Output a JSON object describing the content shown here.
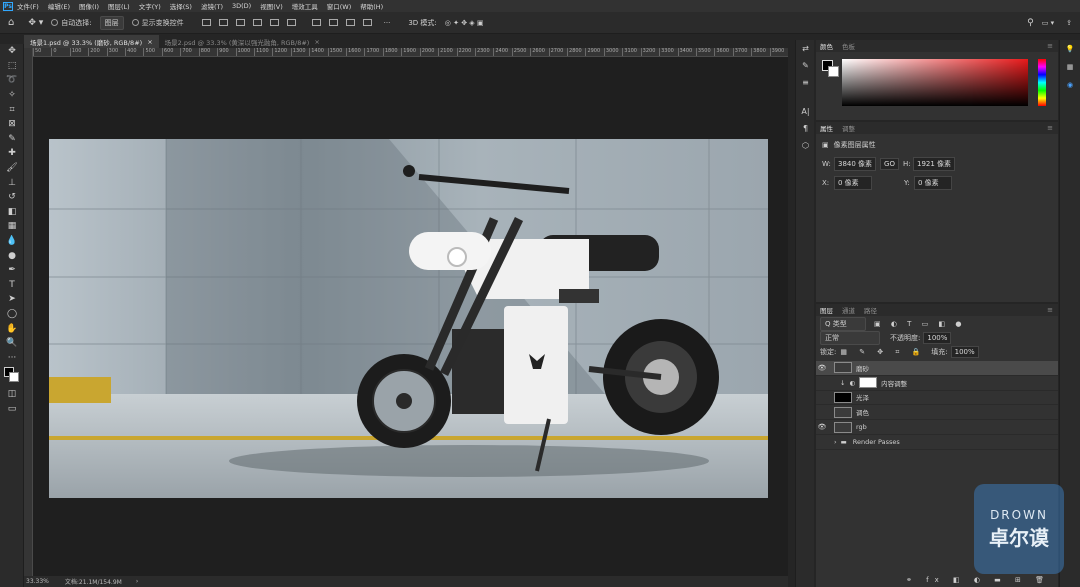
{
  "app": {
    "logo": "Ps"
  },
  "menu": [
    "文件(F)",
    "编辑(E)",
    "图像(I)",
    "图层(L)",
    "文字(Y)",
    "选择(S)",
    "滤镜(T)",
    "3D(D)",
    "视图(V)",
    "增效工具",
    "窗口(W)",
    "帮助(H)"
  ],
  "options": {
    "auto_select": "自动选择:",
    "auto_select_value": "图层",
    "show_transform": "显示变换控件",
    "mode_3d": "3D 模式:"
  },
  "tabs": [
    {
      "label": "场景1.psd @ 33.3% (磨砂, RGB/8#)",
      "active": true
    },
    {
      "label": "场景2.psd @ 33.3% (黄深以强光融角, RGB/8#)",
      "active": false
    }
  ],
  "ruler_ticks": [
    "50",
    "0",
    "100",
    "200",
    "300",
    "400",
    "500",
    "600",
    "700",
    "800",
    "900",
    "1000",
    "1100",
    "1200",
    "1300",
    "1400",
    "1500",
    "1600",
    "1700",
    "1800",
    "1900",
    "2000",
    "2100",
    "2200",
    "2300",
    "2400",
    "2500",
    "2600",
    "2700",
    "2800",
    "2900",
    "3000",
    "3100",
    "3200",
    "3300",
    "3400",
    "3500",
    "3600",
    "3700",
    "3800",
    "3900"
  ],
  "status": {
    "zoom": "33.33%",
    "doc": "文档:21.1M/154.9M"
  },
  "color_panel": {
    "tabs": [
      "颜色",
      "色板"
    ]
  },
  "properties": {
    "tabs": [
      "属性",
      "调整"
    ],
    "title": "像素图层属性",
    "w_label": "W:",
    "w_value": "3840 像素",
    "h_label": "H:",
    "h_value": "1921 像素",
    "x_label": "X:",
    "x_value": "0 像素",
    "y_label": "Y:",
    "y_value": "0 像素",
    "link": "GO"
  },
  "layers_panel": {
    "tabs": [
      "图层",
      "通道",
      "路径"
    ],
    "filter": "Q 类型",
    "blend": "正常",
    "opacity_label": "不透明度:",
    "opacity": "100%",
    "lock_label": "锁定:",
    "fill_label": "填充:",
    "fill": "100%",
    "layers": [
      {
        "name": "磨砂",
        "visible": true,
        "selected": true,
        "thumb": "img"
      },
      {
        "name": "内容调整",
        "visible": false,
        "selected": false,
        "thumb": "white",
        "indent": true
      },
      {
        "name": "光泽",
        "visible": false,
        "selected": false,
        "thumb": "black"
      },
      {
        "name": "调色",
        "visible": false,
        "selected": false,
        "thumb": "img"
      },
      {
        "name": "rgb",
        "visible": true,
        "selected": false,
        "thumb": "img"
      },
      {
        "name": "Render Passes",
        "visible": false,
        "selected": false,
        "thumb": "folder"
      }
    ]
  },
  "watermark": {
    "line1": "DROWN",
    "line2": "卓尔谟"
  }
}
